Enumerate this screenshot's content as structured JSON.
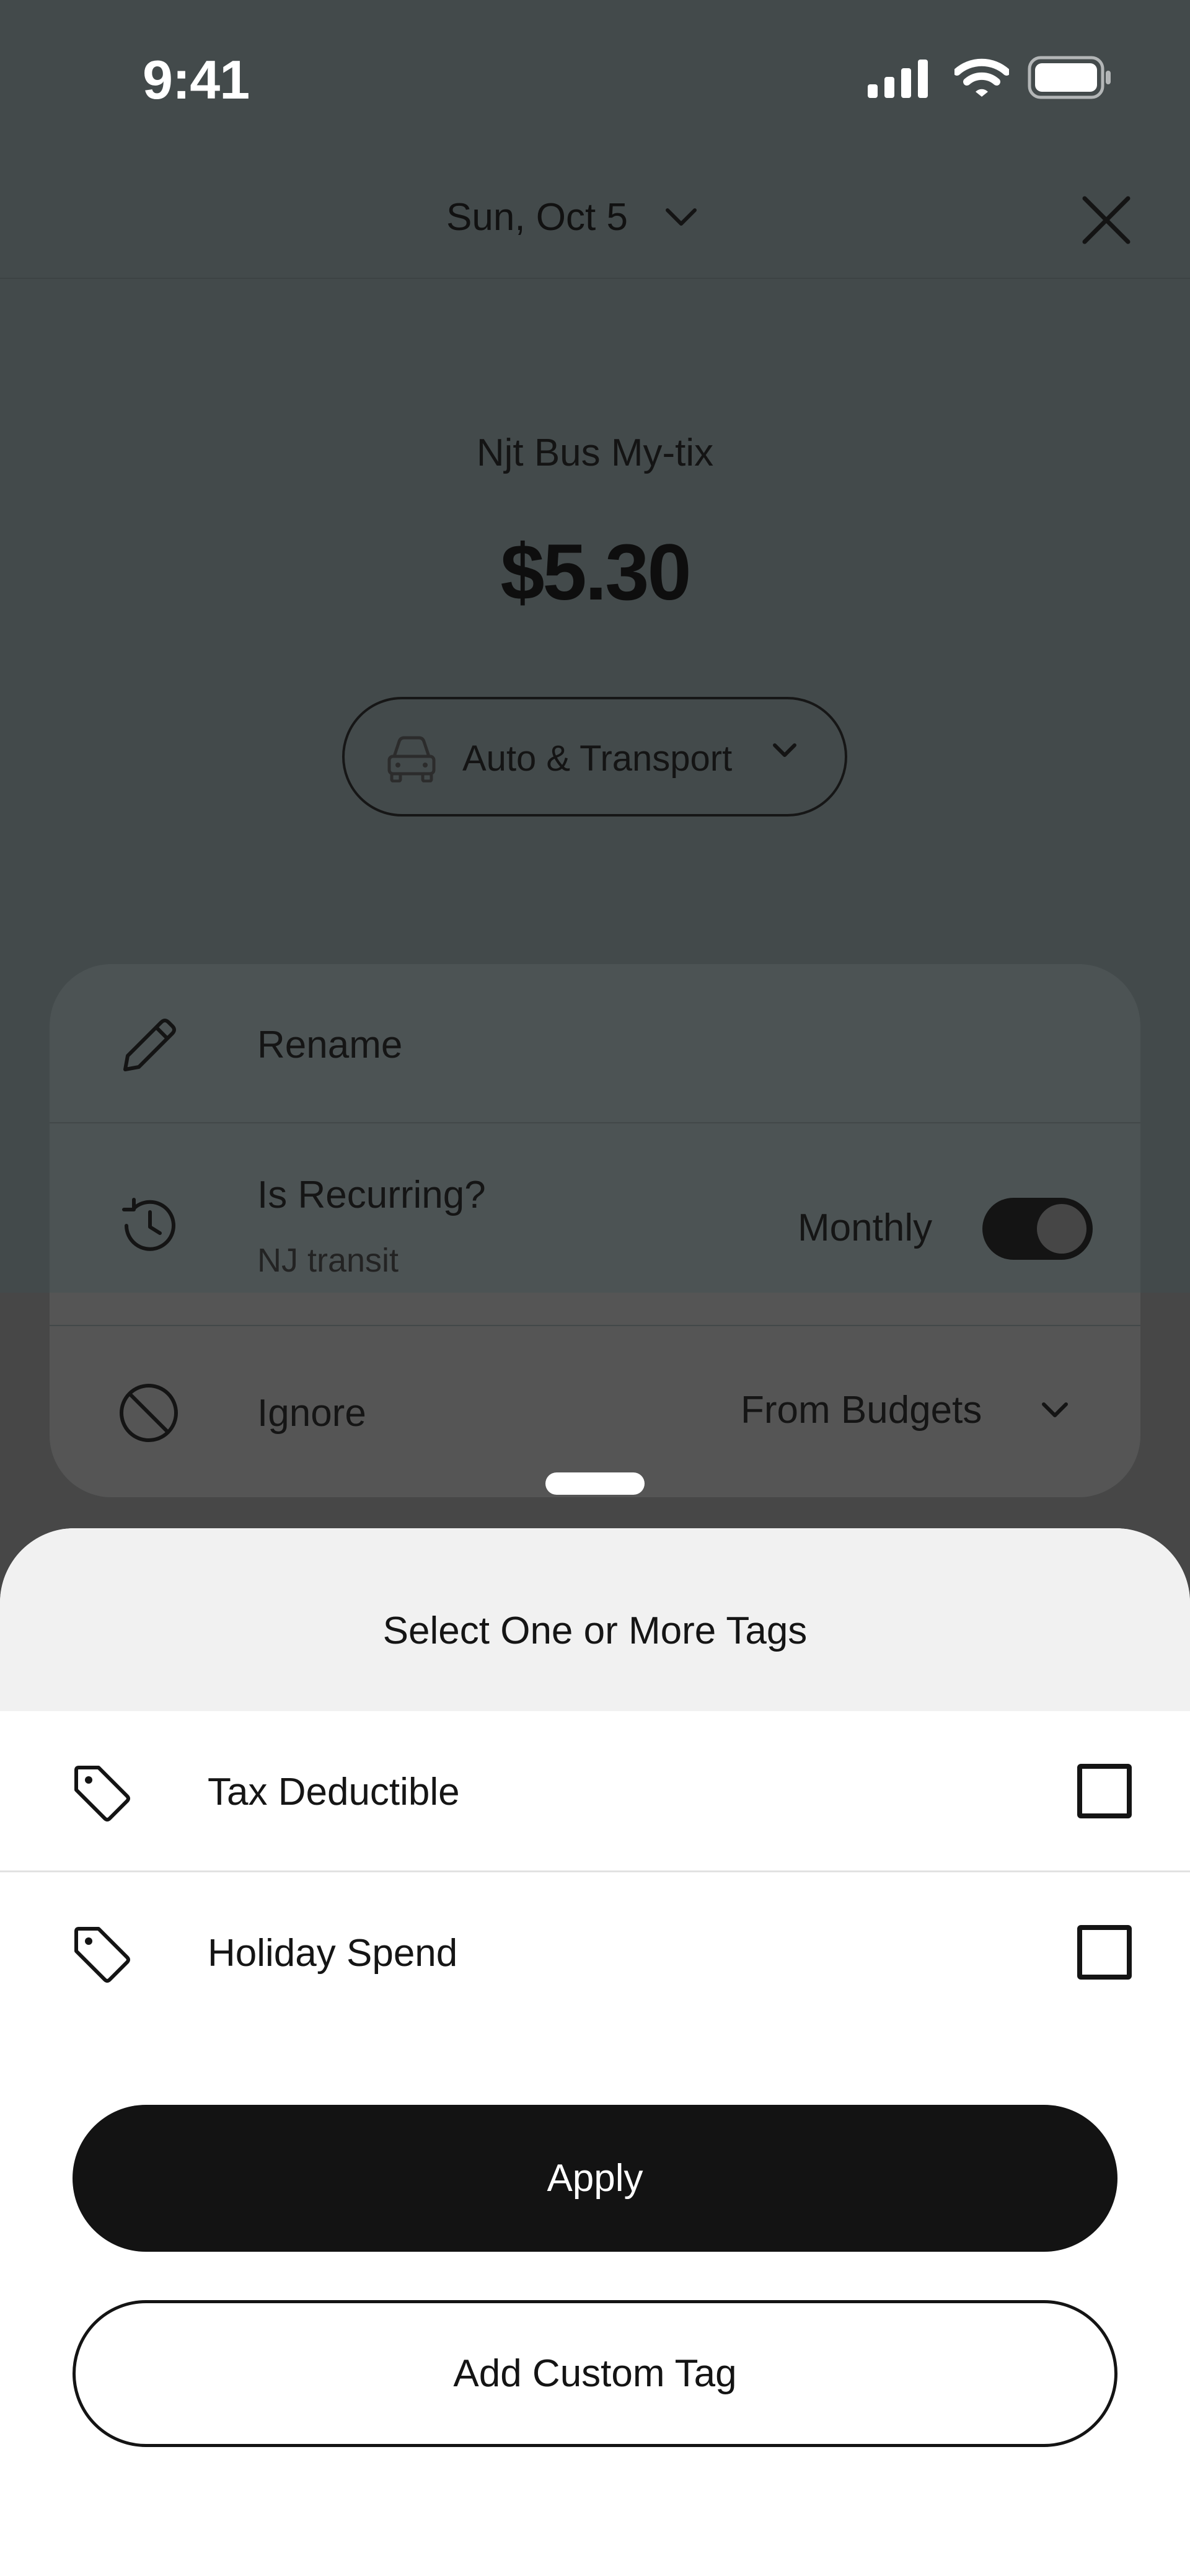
{
  "status_bar": {
    "time": "9:41",
    "icons": [
      "cellular-signal-icon",
      "wifi-icon",
      "battery-icon"
    ]
  },
  "header": {
    "date": "Sun, Oct 5",
    "icons": [
      "chevron-down-icon",
      "close-icon"
    ]
  },
  "transaction": {
    "merchant": "Njt Bus My-tix",
    "amount": "$5.30",
    "category": {
      "label": "Auto & Transport",
      "icon": "car-icon"
    }
  },
  "settings": {
    "rename": {
      "label": "Rename",
      "icon": "pencil-icon"
    },
    "recurring": {
      "label": "Is Recurring?",
      "sublabel": "NJ transit",
      "frequency": "Monthly",
      "enabled": true,
      "icon": "history-icon"
    },
    "ignore": {
      "label": "Ignore",
      "value": "From Budgets",
      "icon": "block-icon"
    }
  },
  "tag_sheet": {
    "title": "Select One or More Tags",
    "tags": [
      {
        "label": "Tax Deductible",
        "checked": false,
        "icon": "tag-icon"
      },
      {
        "label": "Holiday Spend",
        "checked": false,
        "icon": "tag-icon"
      }
    ],
    "apply_label": "Apply",
    "add_custom_label": "Add Custom Tag"
  },
  "colors": {
    "backdrop_teal": "#434a4b",
    "backdrop_gray": "#474747",
    "primary": "#131313",
    "sheet_header": "#f1f1f1"
  }
}
